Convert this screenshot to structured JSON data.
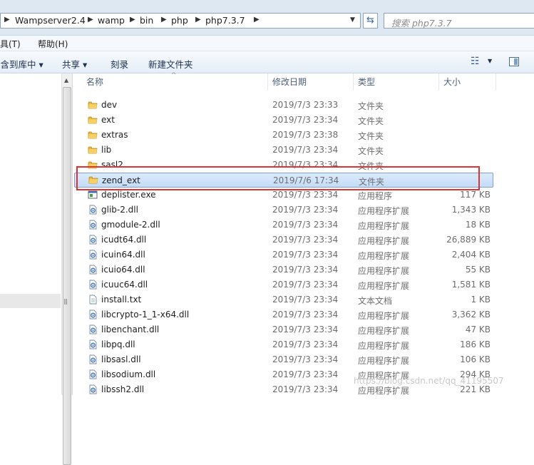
{
  "address_bar": {
    "breadcrumbs": [
      "Wampserver2.4",
      "wamp",
      "bin",
      "php",
      "php7.3.7"
    ],
    "search_placeholder": "搜索 php7.3.7"
  },
  "menu": {
    "tools": "工具(T)",
    "help": "帮助(H)"
  },
  "toolbar": {
    "include_in_library": "包含到库中 ▾",
    "share": "共享 ▾",
    "burn": "刻录",
    "new_folder": "新建文件夹"
  },
  "columns": {
    "name": "名称",
    "date_modified": "修改日期",
    "type": "类型",
    "size": "大小"
  },
  "files": [
    {
      "name": "dev",
      "date": "2019/7/3 23:33",
      "type": "文件夹",
      "size": "",
      "icon": "folder-icon"
    },
    {
      "name": "ext",
      "date": "2019/7/3 23:34",
      "type": "文件夹",
      "size": "",
      "icon": "folder-icon"
    },
    {
      "name": "extras",
      "date": "2019/7/3 23:38",
      "type": "文件夹",
      "size": "",
      "icon": "folder-icon"
    },
    {
      "name": "lib",
      "date": "2019/7/3 23:34",
      "type": "文件夹",
      "size": "",
      "icon": "folder-icon"
    },
    {
      "name": "sasl2",
      "date": "2019/7/3 23:34",
      "type": "文件夹",
      "size": "",
      "icon": "folder-icon"
    },
    {
      "name": "zend_ext",
      "date": "2019/7/6 17:34",
      "type": "文件夹",
      "size": "",
      "icon": "folder-icon",
      "selected": true
    },
    {
      "name": "deplister.exe",
      "date": "2019/7/3 23:34",
      "type": "应用程序",
      "size": "117 KB",
      "icon": "exe-icon"
    },
    {
      "name": "glib-2.dll",
      "date": "2019/7/3 23:34",
      "type": "应用程序扩展",
      "size": "1,343 KB",
      "icon": "dll-icon"
    },
    {
      "name": "gmodule-2.dll",
      "date": "2019/7/3 23:34",
      "type": "应用程序扩展",
      "size": "18 KB",
      "icon": "dll-icon"
    },
    {
      "name": "icudt64.dll",
      "date": "2019/7/3 23:34",
      "type": "应用程序扩展",
      "size": "26,889 KB",
      "icon": "dll-icon"
    },
    {
      "name": "icuin64.dll",
      "date": "2019/7/3 23:34",
      "type": "应用程序扩展",
      "size": "2,404 KB",
      "icon": "dll-icon"
    },
    {
      "name": "icuio64.dll",
      "date": "2019/7/3 23:34",
      "type": "应用程序扩展",
      "size": "55 KB",
      "icon": "dll-icon"
    },
    {
      "name": "icuuc64.dll",
      "date": "2019/7/3 23:34",
      "type": "应用程序扩展",
      "size": "1,581 KB",
      "icon": "dll-icon"
    },
    {
      "name": "install.txt",
      "date": "2019/7/3 23:34",
      "type": "文本文档",
      "size": "1 KB",
      "icon": "txt-icon"
    },
    {
      "name": "libcrypto-1_1-x64.dll",
      "date": "2019/7/3 23:34",
      "type": "应用程序扩展",
      "size": "3,362 KB",
      "icon": "dll-icon"
    },
    {
      "name": "libenchant.dll",
      "date": "2019/7/3 23:34",
      "type": "应用程序扩展",
      "size": "47 KB",
      "icon": "dll-icon"
    },
    {
      "name": "libpq.dll",
      "date": "2019/7/3 23:34",
      "type": "应用程序扩展",
      "size": "186 KB",
      "icon": "dll-icon"
    },
    {
      "name": "libsasl.dll",
      "date": "2019/7/3 23:34",
      "type": "应用程序扩展",
      "size": "106 KB",
      "icon": "dll-icon"
    },
    {
      "name": "libsodium.dll",
      "date": "2019/7/3 23:34",
      "type": "应用程序扩展",
      "size": "294 KB",
      "icon": "dll-icon"
    },
    {
      "name": "libssh2.dll",
      "date": "2019/7/3 23:34",
      "type": "应用程序扩展",
      "size": "221 KB",
      "icon": "dll-icon"
    }
  ],
  "watermark": "https://blog.csdn.net/qq_41195507"
}
